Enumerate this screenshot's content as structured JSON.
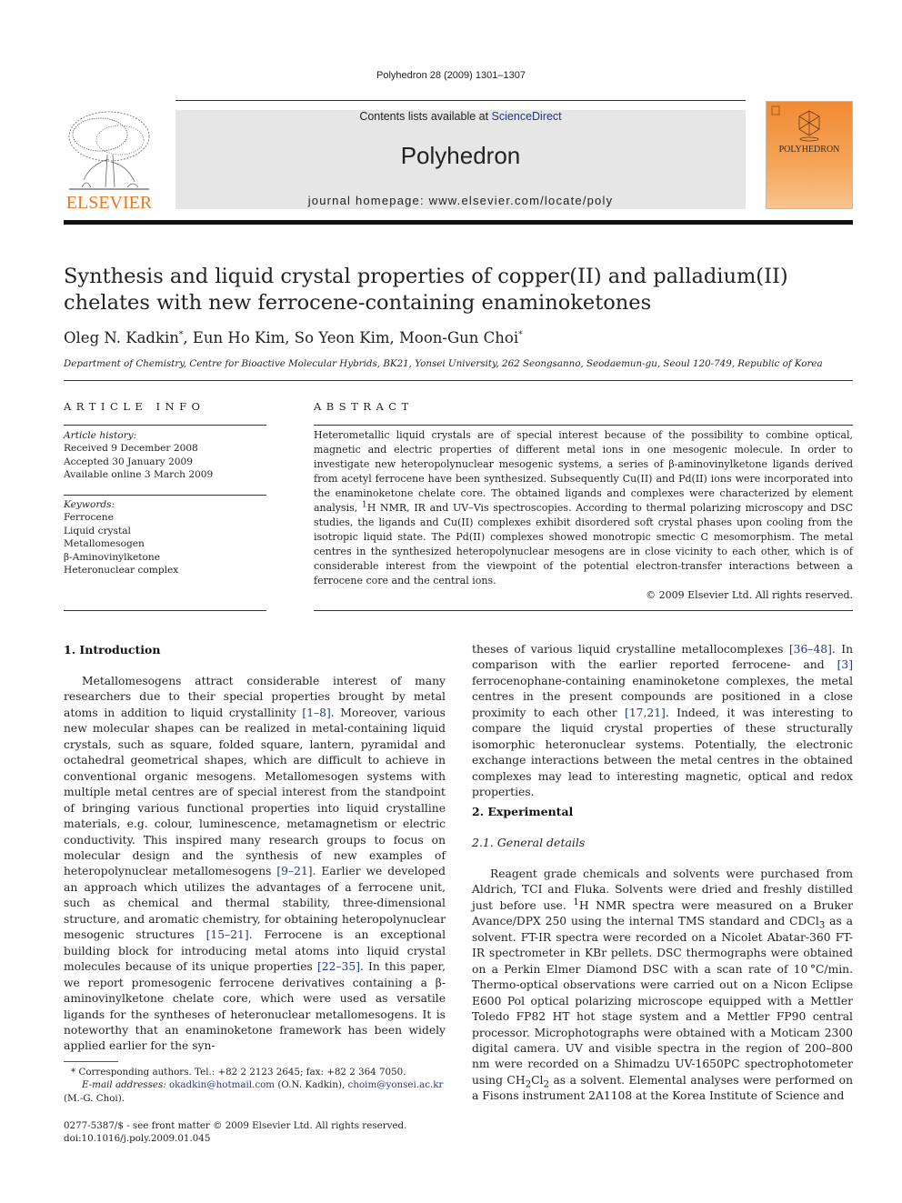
{
  "running_head": "Polyhedron 28 (2009) 1301–1307",
  "banner": {
    "contents_prefix": "Contents lists available at ",
    "contents_link": "ScienceDirect",
    "journal_name": "Polyhedron",
    "homepage": "journal homepage: www.elsevier.com/locate/poly",
    "publisher_logo_text": "ELSEVIER",
    "cover_title": "POLYHEDRON",
    "brand_color": "#e87722",
    "cover_color": "#f18b33"
  },
  "article": {
    "title": "Synthesis and liquid crystal properties of copper(II) and palladium(II) chelates with new ferrocene-containing enaminoketones",
    "authors": [
      {
        "name": "Oleg N. Kadkin",
        "mark": "*"
      },
      {
        "name": "Eun Ho Kim",
        "mark": ""
      },
      {
        "name": "So Yeon Kim",
        "mark": ""
      },
      {
        "name": "Moon-Gun Choi",
        "mark": "*"
      }
    ],
    "affiliation": "Department of Chemistry, Centre for Bioactive Molecular Hybrids, BK21, Yonsei University, 262 Seongsanno, Seodaemun-gu, Seoul 120-749, Republic of Korea"
  },
  "article_info": {
    "heading": "ARTICLE INFO",
    "history_label": "Article history:",
    "history": [
      "Received 9 December 2008",
      "Accepted 30 January 2009",
      "Available online 3 March 2009"
    ],
    "keywords_label": "Keywords:",
    "keywords": [
      "Ferrocene",
      "Liquid crystal",
      "Metallomesogen",
      "β-Aminovinylketone",
      "Heteronuclear complex"
    ]
  },
  "abstract": {
    "heading": "ABSTRACT",
    "text_1": "Heterometallic liquid crystals are of special interest because of the possibility to combine optical, magnetic and electric properties of different metal ions in one mesogenic molecule. In order to investigate new heteropolynuclear mesogenic systems, a series of β-aminovinylketone ligands derived from acetyl ferrocene have been synthesized. Subsequently Cu(II) and Pd(II) ions were incorporated into the enaminoketone chelate core. The obtained ligands and complexes were characterized by element analysis, ",
    "sup_1": "1",
    "text_2": "H NMR, IR and UV–Vis spectroscopies. According to thermal polarizing microscopy and DSC studies, the ligands and Cu(II) complexes exhibit disordered soft crystal phases upon cooling from the isotropic liquid state. The Pd(II) complexes showed monotropic smectic C mesomorphism. The metal centres in the synthesized heteropolynuclear mesogens are in close vicinity to each other, which is of considerable interest from the viewpoint of the potential electron-transfer interactions between a ferrocene core and the central ions.",
    "copyright": "© 2009 Elsevier Ltd. All rights reserved."
  },
  "intro": {
    "heading": "1. Introduction",
    "p1": [
      {
        "t": "Metallomesogens attract considerable interest of many researchers due to their special properties brought by metal atoms in addition to liquid crystallinity "
      },
      {
        "r": "[1–8]"
      },
      {
        "t": ". Moreover, various new molecular shapes can be realized in metal-containing liquid crystals, such as square, folded square, lantern, pyramidal and octahedral geometrical shapes, which are difficult to achieve in conventional organic mesogens. Metallomesogen systems with multiple metal centres are of special interest from the standpoint of bringing various functional properties into liquid crystalline materials, e.g. colour, luminescence, metamagnetism or electric conductivity. This inspired many research groups to focus on molecular design and the synthesis of new examples of heteropolynuclear metallomesogens "
      },
      {
        "r": "[9–21]"
      },
      {
        "t": ". Earlier we developed an approach which utilizes the advantages of a ferrocene unit, such as chemical and thermal stability, three-dimensional structure, and aromatic chemistry, for obtaining heteropolynuclear mesogenic structures "
      },
      {
        "r": "[15–21]"
      },
      {
        "t": ". Ferrocene is an exceptional building block for introducing metal atoms into liquid crystal molecules because of its unique properties "
      },
      {
        "r": "[22–35]"
      },
      {
        "t": ". In this paper, we report promesogenic ferrocene derivatives containing a β-aminovinylketone chelate core, which were used as versatile ligands for the syntheses of heteronuclear metallomesogens. It is noteworthy that an enaminoketone framework has been widely applied earlier for the syn-"
      }
    ],
    "p1_cont": [
      {
        "t": "theses of various liquid crystalline metallocomplexes "
      },
      {
        "r": "[36–48]"
      },
      {
        "t": ". In comparison with the earlier reported ferrocene- and "
      },
      {
        "r": "[3]"
      },
      {
        "t": " ferrocenophane-containing enaminoketone complexes, the metal centres in the present compounds are positioned in a close proximity to each other "
      },
      {
        "r": "[17,21]"
      },
      {
        "t": ". Indeed, it was interesting to compare the liquid crystal properties of these structurally isomorphic heteronuclear systems. Potentially, the electronic exchange interactions between the metal centres in the obtained complexes may lead to interesting magnetic, optical and redox properties."
      }
    ]
  },
  "experimental": {
    "heading": "2. Experimental",
    "subheading": "2.1. General details",
    "p1": [
      {
        "t": "Reagent grade chemicals and solvents were purchased from Aldrich, TCI and Fluka. Solvents were dried and freshly distilled just before use. "
      },
      {
        "sup": "1"
      },
      {
        "t": "H NMR spectra were measured on a Bruker Avance/DPX 250 using the internal TMS standard and CDCl"
      },
      {
        "sub": "3"
      },
      {
        "t": " as a solvent. FT-IR spectra were recorded on a Nicolet Abatar-360 FT-IR spectrometer in KBr pellets. DSC thermographs were obtained on a Perkin Elmer Diamond DSC with a scan rate of 10 °C/min. Thermo-optical observations were carried out on a Nicon Eclipse E600 Pol optical polarizing microscope equipped with a Mettler Toledo FP82 HT hot stage system and a Mettler FP90 central processor. Microphotographs were obtained with a Moticam 2300 digital camera. UV and visible spectra in the region of 200–800 nm were recorded on a Shimadzu UV-1650PC spectrophotometer using CH"
      },
      {
        "sub": "2"
      },
      {
        "t": "Cl"
      },
      {
        "sub": "2"
      },
      {
        "t": " as a solvent. Elemental analyses were performed on a Fisons instrument 2A1108 at the Korea Institute of Science and"
      }
    ]
  },
  "footnote": {
    "mark": "*",
    "corresponding": "Corresponding authors. Tel.: +82 2 2123 2645; fax: +82 2 364 7050.",
    "email_label": "E-mail addresses:",
    "email_1": "okadkin@hotmail.com",
    "email_1_owner": "(O.N. Kadkin),",
    "email_2": "choim@yonsei.ac.kr",
    "email_2_owner": "(M.-G. Choi)."
  },
  "front_matter": {
    "issn": "0277-5387/$ - see front matter © 2009 Elsevier Ltd. All rights reserved.",
    "doi": "doi:10.1016/j.poly.2009.01.045"
  }
}
